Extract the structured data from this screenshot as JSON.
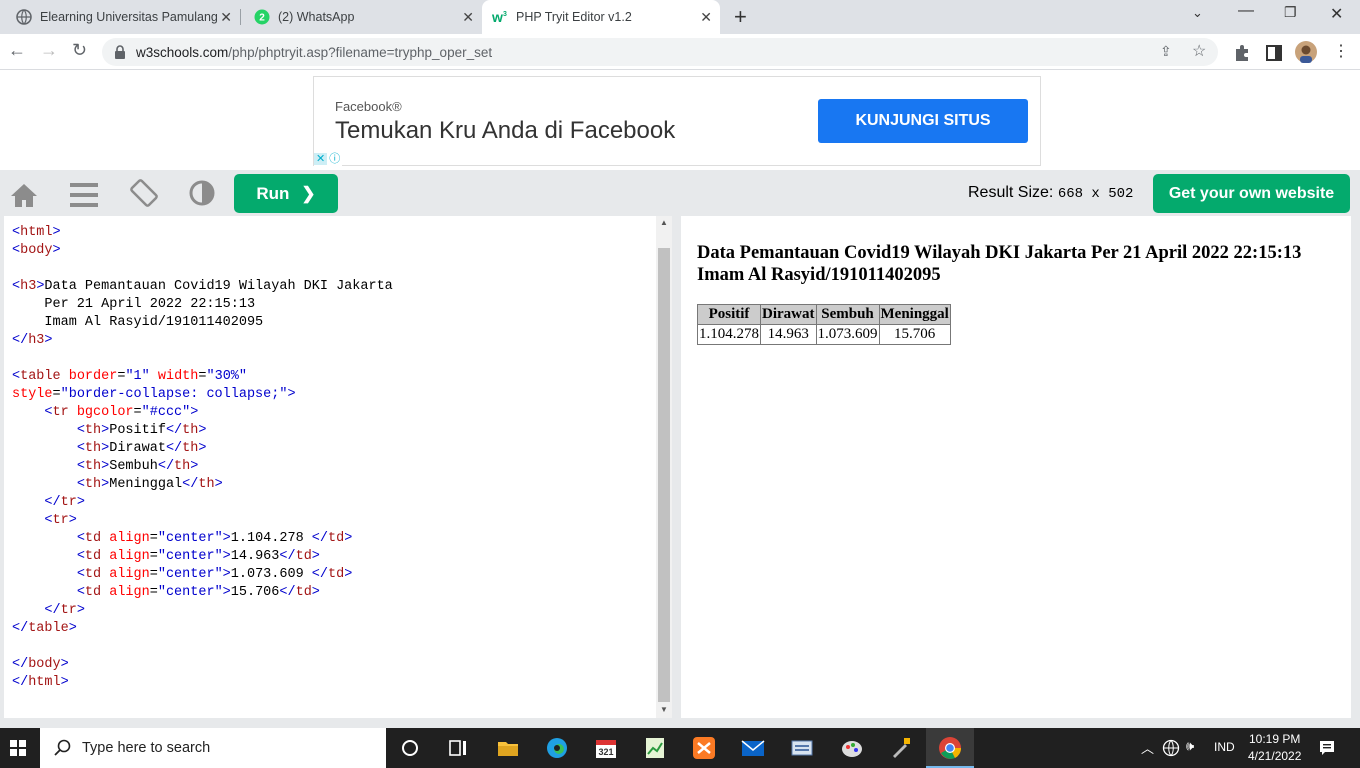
{
  "browser": {
    "tabs": [
      {
        "title": "Elearning Universitas Pamulang"
      },
      {
        "title": "(2) WhatsApp",
        "badge": "2"
      },
      {
        "title": "PHP Tryit Editor v1.2"
      }
    ],
    "url_domain": "w3schools.com",
    "url_path": "/php/phptryit.asp?filename=tryphp_oper_set"
  },
  "ad": {
    "brand": "Facebook®",
    "headline": "Temukan Kru Anda di Facebook",
    "cta": "KUNJUNGI SITUS"
  },
  "toolbar": {
    "run_label": "Run",
    "result_size_label": "Result Size:",
    "result_size_value": "668 x 502",
    "get_website_label": "Get your own website"
  },
  "result": {
    "heading_line1": "Data Pemantauan Covid19 Wilayah DKI Jakarta Per 21 April 2022 22:15:13",
    "heading_line2": "Imam Al Rasyid/191011402095",
    "table": {
      "headers": [
        "Positif",
        "Dirawat",
        "Sembuh",
        "Meninggal"
      ],
      "row": [
        "1.104.278",
        "14.963",
        "1.073.609",
        "15.706"
      ]
    }
  },
  "taskbar": {
    "search_placeholder": "Type here to search",
    "language": "IND",
    "time": "10:19 PM",
    "date": "4/21/2022"
  }
}
